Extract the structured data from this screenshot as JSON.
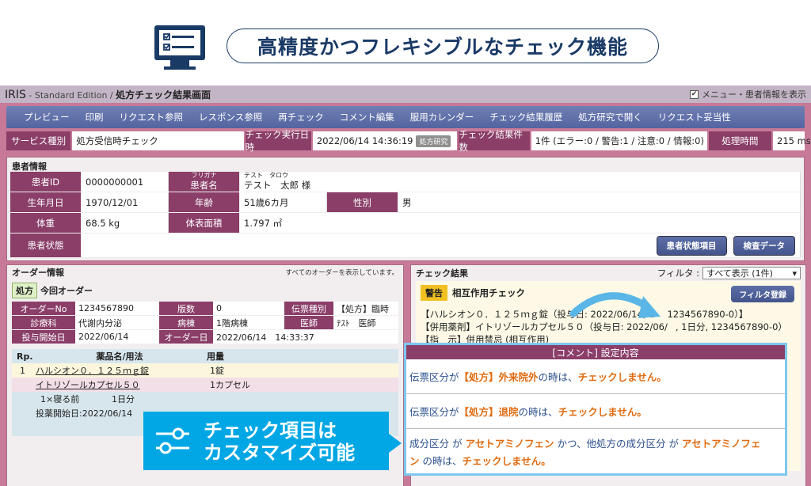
{
  "headline": {
    "text": "高精度かつフレキシブルなチェック機能"
  },
  "titlebar": {
    "brand": "IRIS",
    "edition": " - Standard Edition / ",
    "page": "処方チェック結果画面",
    "menu_toggle": "メニュー・患者情報を表示",
    "menu_toggle_checked": "✔"
  },
  "menu": [
    "プレビュー",
    "印刷",
    "リクエスト参照",
    "レスポンス参照",
    "再チェック",
    "コメント編集",
    "服用カレンダー",
    "チェック結果履歴",
    "処方研究で開く",
    "リクエスト妥当性"
  ],
  "service": {
    "type_label": "サービス種別",
    "type_value": "処方受信時チェック",
    "exec_label": "チェック実行日時",
    "exec_value": "2022/06/14 14:36:19",
    "exec_badge": "処方研究",
    "count_label": "チェック結果件数",
    "count_value": "1件 (エラー:0 / 警告:1 / 注意:0 / 情報:0)",
    "time_label": "処理時間",
    "time_value": "215 ms"
  },
  "patient": {
    "title": "患者情報",
    "id_label": "患者ID",
    "id_value": "0000000001",
    "furigana_label": "フリガナ",
    "name_label": "患者名",
    "furigana_value": "テスト　タロウ",
    "name_value": "テスト　太郎 様",
    "dob_label": "生年月日",
    "dob_value": "1970/12/01",
    "age_label": "年齢",
    "age_value": "51歳6カ月",
    "sex_label": "性別",
    "sex_value": "男",
    "weight_label": "体重",
    "weight_value": "68.5 kg",
    "bsa_label": "体表面積",
    "bsa_value": "1.797 ㎡",
    "status_label": "患者状態",
    "btn_status": "患者状態項目",
    "btn_lab": "検査データ"
  },
  "order": {
    "title": "オーダー情報",
    "note": "すべてのオーダーを表示しています。",
    "tag": "処方",
    "current": "今回オーダー",
    "no_label": "オーダーNo",
    "no_value": "1234567890",
    "ver_label": "版数",
    "ver_value": "0",
    "slip_label": "伝票種別",
    "slip_value": "【処方】臨時",
    "dept_label": "診療科",
    "dept_value": "代謝内分泌",
    "ward_label": "病棟",
    "ward_value": "1階病棟",
    "doctor_label": "医師",
    "doctor_value": "ﾃｽﾄ　医師",
    "start_label": "投与開始日",
    "start_value": "2022/06/14",
    "odate_label": "オーダー日",
    "odate_value": "2022/06/14　14:33:37",
    "rx": {
      "col_rp": "Rp.",
      "col_drug": "薬品名/用法",
      "col_qty": "用量",
      "rp_no": "1",
      "drug1": "ハルシオン０．１２５ｍｇ錠",
      "qty1": "1錠",
      "drug2": "イトリゾールカプセル５０",
      "qty2": "1カプセル",
      "usage": "1×寝る前",
      "days": "1日分",
      "start": "投薬開始日:2022/06/14"
    }
  },
  "check": {
    "title": "チェック結果",
    "filter_label": "フィルタ :",
    "filter_value": "すべて表示 (1件)",
    "filter_btn": "フィルタ登録",
    "badge": "警告",
    "type": "相互作用チェック",
    "line1": "【ハルシオン０．１２５ｍｇ錠（投与日: 2022/06/14, 1",
    "line1_end": "1234567890-0）】",
    "line2": "【併用薬剤】イトリゾールカプセル５０（投与日: 2022/06/",
    "line2_end": ", 1日分, 1234567890-0）",
    "line3": "【指　示】併用禁忌 (相互作用)"
  },
  "comment": {
    "title": "[コメント] 設定内容",
    "rows": [
      {
        "a": "伝票区分",
        "b": " が ",
        "c": "【処方】外来院外",
        "d": " の時は、",
        "e": "チェックしません。"
      },
      {
        "a": "伝票区分",
        "b": " が ",
        "c": "【処方】退院",
        "d": " の時は、",
        "e": "チェックしません。"
      }
    ],
    "row3_a": "成分区分",
    "row3_b": " が ",
    "row3_c": "アセトアミノフェン",
    "row3_d": " かつ、他処方の成分区分 ",
    "row3_e": "が ",
    "row3_f": "アセトアミノフェ",
    "row3_g": "ン",
    "row3_h": " の時は、",
    "row3_i": "チェックしません。"
  },
  "callout": {
    "line1": "チェック項目は",
    "line2": "カスタマイズ可能"
  },
  "colors": {
    "accent": "#8a3e68",
    "menu": "#5464a0",
    "callout": "#00a7e4",
    "orange": "#e06b10"
  }
}
